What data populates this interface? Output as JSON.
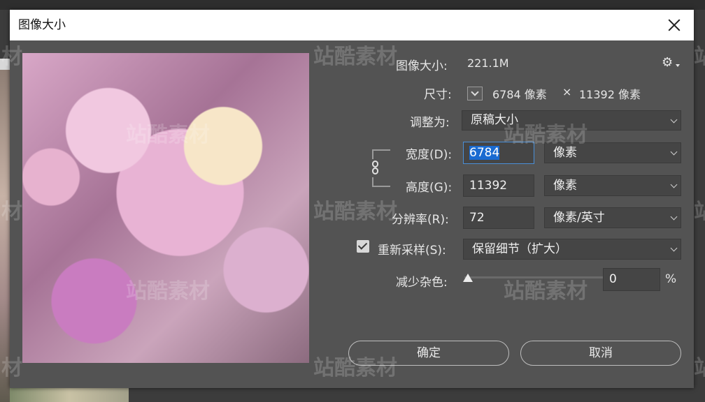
{
  "dialog": {
    "title": "图像大小",
    "image_size_label": "图像大小:",
    "image_size_value": "221.1M",
    "dimensions_label": "尺寸:",
    "dimensions_width": "6784 像素",
    "dimensions_times": "×",
    "dimensions_height": "11392 像素",
    "fit_to_label": "调整为:",
    "fit_to_value": "原稿大小",
    "width_label": "宽度(D):",
    "width_value": "6784",
    "width_unit": "像素",
    "height_label": "高度(G):",
    "height_value": "11392",
    "height_unit": "像素",
    "resolution_label": "分辨率(R):",
    "resolution_value": "72",
    "resolution_unit": "像素/英寸",
    "resample_label": "重新采样(S):",
    "resample_value": "保留细节（扩大）",
    "noise_label": "减少杂色:",
    "noise_value": "0",
    "noise_unit": "%",
    "ok_label": "确定",
    "cancel_label": "取消"
  },
  "state": {
    "resample_checked": true,
    "noise_level_percent": 0
  },
  "watermark": {
    "text": "站酷素材",
    "partial": "材",
    "partial_right": "站"
  },
  "icons": {
    "close": "close-icon",
    "settings": "gear-icon",
    "link": "chain-link-icon",
    "checkbox": "checkbox-checked-icon"
  },
  "colors": {
    "dialog_bg": "#535353",
    "field_bg": "#454545",
    "focus": "#4a8fd8",
    "selection": "#1a6bd1"
  }
}
